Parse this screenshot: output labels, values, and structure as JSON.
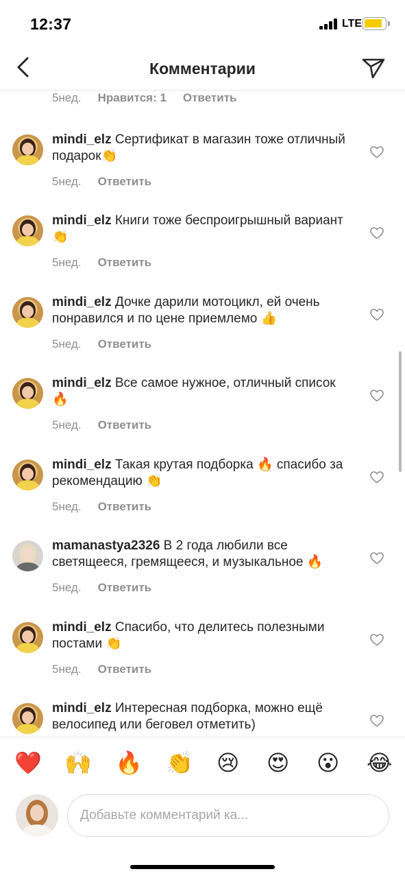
{
  "status_bar": {
    "time": "12:37",
    "network": "LTE",
    "battery_color": "#f5cc00"
  },
  "header": {
    "title": "Комментарии",
    "back_icon": "chevron-left-icon",
    "send_icon": "paper-plane-icon"
  },
  "partial_comment": {
    "time": "5нед.",
    "likes": "Нравится: 1",
    "reply": "Ответить"
  },
  "comments": [
    {
      "username": "mindi_elz",
      "text": "Сертификат в магазин тоже отличный подарок👏",
      "time": "5нед.",
      "reply": "Ответить"
    },
    {
      "username": "mindi_elz",
      "text": "Книги тоже беспроигрышный вариант 👏",
      "time": "5нед.",
      "reply": "Ответить"
    },
    {
      "username": "mindi_elz",
      "text": "Дочке дарили мотоцикл, ей очень понравился и по цене приемлемо 👍",
      "time": "5нед.",
      "reply": "Ответить"
    },
    {
      "username": "mindi_elz",
      "text": "Все самое нужное, отличный список 🔥",
      "time": "5нед.",
      "reply": "Ответить"
    },
    {
      "username": "mindi_elz",
      "text": "Такая крутая подборка 🔥 спасибо за рекомендацию 👏",
      "time": "5нед.",
      "reply": "Ответить"
    },
    {
      "username": "mamanastya2326",
      "text": "В 2 года любили все светящееся, гремящееся, и музыкальное 🔥",
      "time": "5нед.",
      "reply": "Ответить"
    },
    {
      "username": "mindi_elz",
      "text": "Спасибо, что делитесь полезными постами 👏",
      "time": "5нед.",
      "reply": "Ответить"
    },
    {
      "username": "mindi_elz",
      "text": "Интересная подборка, можно ещё велосипед или беговел отметить)",
      "time": "",
      "reply": ""
    }
  ],
  "emoji_bar": [
    "❤️",
    "🙌",
    "🔥",
    "👏",
    "😢",
    "😍",
    "😮",
    "😂"
  ],
  "composer": {
    "placeholder": "Добавьте комментарий ка..."
  },
  "colors": {
    "text": "#262626",
    "secondary_text": "#8e8e8e",
    "divider": "#e6e6e6"
  }
}
